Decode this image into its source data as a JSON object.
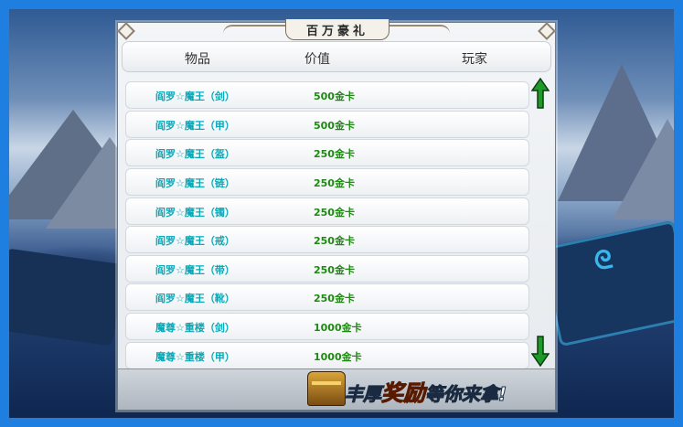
{
  "panel": {
    "title": "百万豪礼"
  },
  "header": {
    "item_label": "物品",
    "value_label": "价值",
    "player_label": "玩家"
  },
  "rows": [
    {
      "item": "阎罗☆魔王（剑）",
      "value": "500金卡"
    },
    {
      "item": "阎罗☆魔王（甲）",
      "value": "500金卡"
    },
    {
      "item": "阎罗☆魔王（盔）",
      "value": "250金卡"
    },
    {
      "item": "阎罗☆魔王（链）",
      "value": "250金卡"
    },
    {
      "item": "阎罗☆魔王（镯）",
      "value": "250金卡"
    },
    {
      "item": "阎罗☆魔王（戒）",
      "value": "250金卡"
    },
    {
      "item": "阎罗☆魔王（带）",
      "value": "250金卡"
    },
    {
      "item": "阎罗☆魔王（靴）",
      "value": "250金卡"
    },
    {
      "item": "魔尊☆重楼（剑）",
      "value": "1000金卡"
    },
    {
      "item": "魔尊☆重楼（甲）",
      "value": "1000金卡"
    }
  ],
  "footer": {
    "banner_part1": "丰厚",
    "banner_part2": "奖励",
    "banner_part3": "等你来拿!"
  },
  "icons": {
    "scroll_up": "up-arrow-icon",
    "scroll_down": "down-arrow-icon",
    "chest": "treasure-chest-icon"
  },
  "colors": {
    "item_text": "#0aa9b8",
    "value_text": "#1e8a12",
    "frame_border": "#1f7fe0",
    "arrow_fill": "#1e9a2a"
  }
}
